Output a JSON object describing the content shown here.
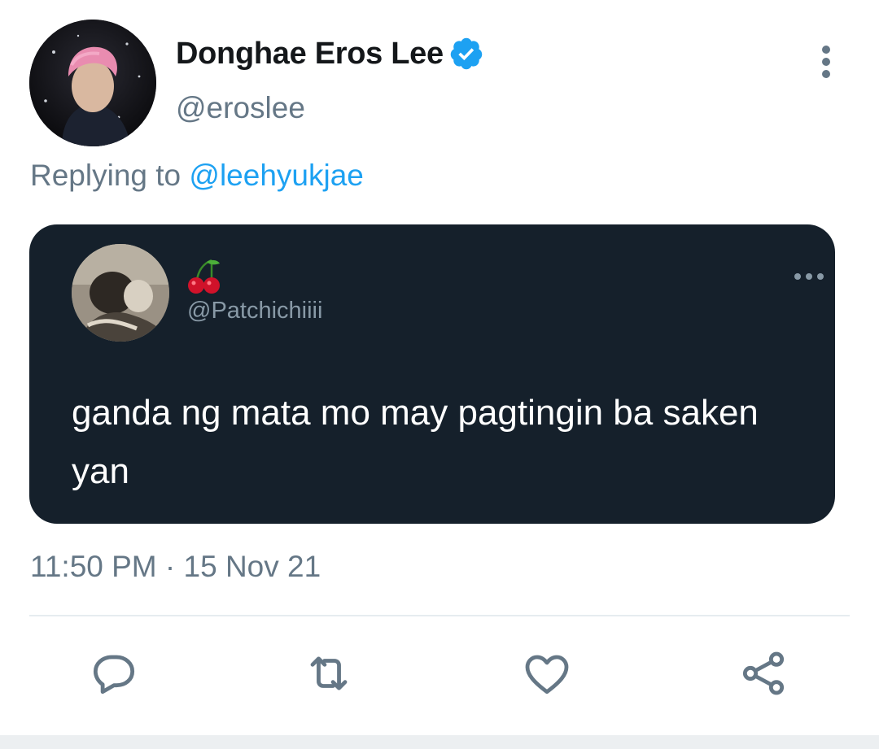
{
  "author": {
    "display_name": "Donghae Eros Lee",
    "handle": "@eroslee",
    "verified": true,
    "verified_icon": "verified-badge-icon"
  },
  "reply_context": {
    "prefix": "Replying to ",
    "mention": "@leehyukjae"
  },
  "quoted": {
    "name_icon": "cherries-emoji-icon",
    "handle": "@Patchichiiii",
    "text": "ganda ng mata mo may pagtingin ba saken yan"
  },
  "timestamp": "11:50 PM · 15 Nov 21",
  "actions": [
    {
      "icon": "reply-icon"
    },
    {
      "icon": "retweet-icon"
    },
    {
      "icon": "like-icon"
    },
    {
      "icon": "share-icon"
    }
  ],
  "colors": {
    "link": "#1da1f2",
    "secondary_text": "#657786",
    "card_bg": "#15202b",
    "verified": "#1da1f2"
  }
}
